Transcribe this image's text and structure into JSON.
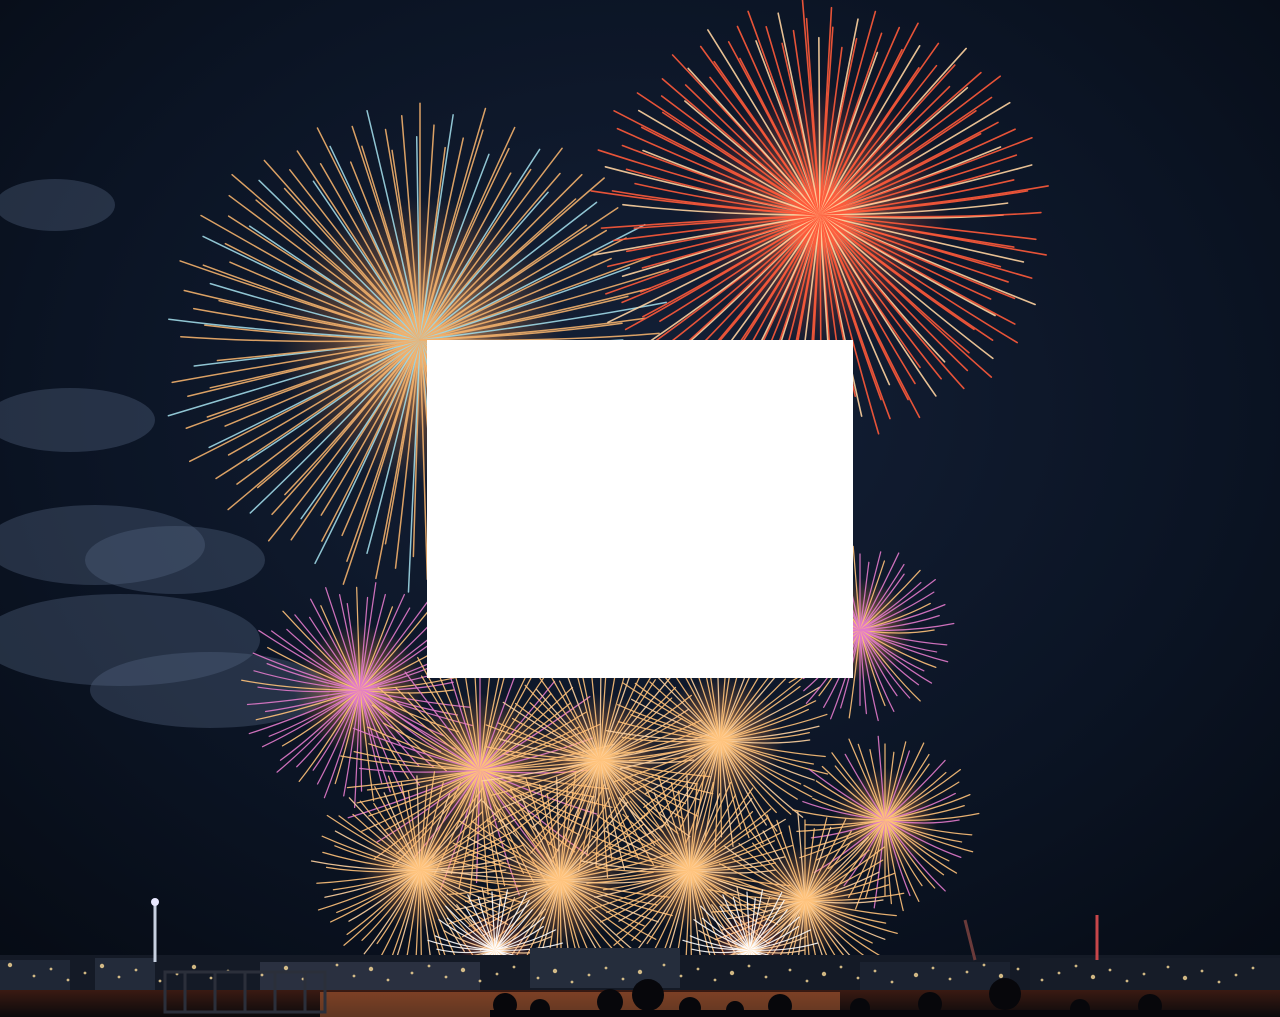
{
  "image": {
    "description_tag": "fireworks-over-harbor-night",
    "colors": {
      "sky_top": "#07101d",
      "sky_mid": "#0f1a2e",
      "cloud": "#5a6a86",
      "burst_teal_gold": "#f2b06c",
      "burst_teal_tips": "#9fd8e6",
      "burst_red_orange": "#ff5a3a",
      "burst_red_core": "#ffd3a0",
      "burst_pink": "#e27acb",
      "burst_gold": "#ffc27a",
      "skyline": "#1b2230",
      "skyline_lights": "#ffdf9a",
      "water_reflection": "#ff9a5a",
      "occluder": "#ffffff"
    },
    "occluder_present": true
  }
}
